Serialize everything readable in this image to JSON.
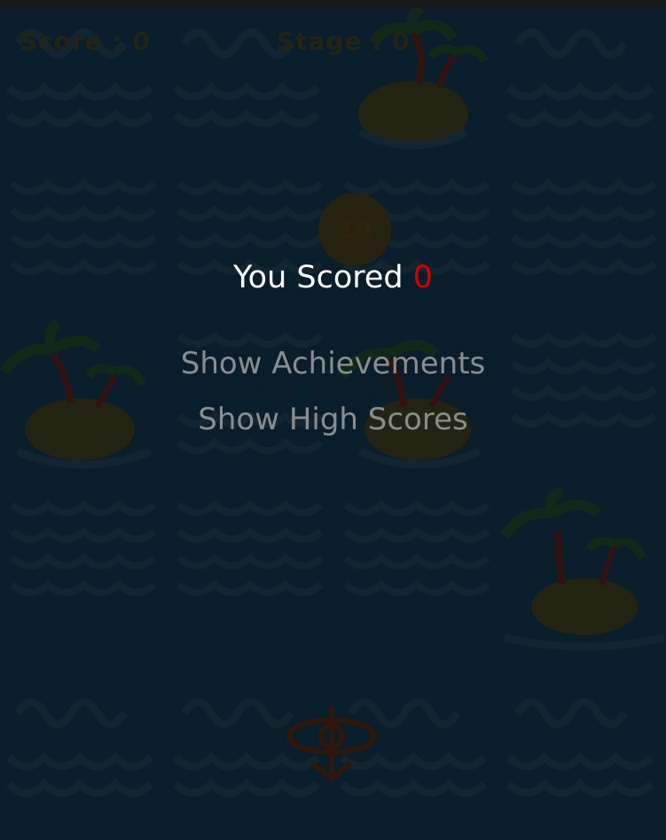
{
  "hud": {
    "score_label": "Score : 0",
    "stage_label": "Stage : 0"
  },
  "timer": {
    "value": "10"
  },
  "ghost_text": "GAME OVER",
  "result": {
    "prefix": "You Scored ",
    "score": "0"
  },
  "menu": {
    "achievements": "Show Achievements",
    "high_scores": "Show High Scores"
  },
  "colors": {
    "score_value": "#d40000",
    "menu_text": "#8a8d8e",
    "board_bg": "#0c2130",
    "wave": "#172b38",
    "island": "#2a2a14",
    "palm_leaf": "#14301a",
    "palm_trunk": "#3a1414"
  },
  "icons": [
    "wave-tile-icon",
    "curl-wave-tile-icon",
    "palm-island-icon",
    "plane-icon"
  ]
}
